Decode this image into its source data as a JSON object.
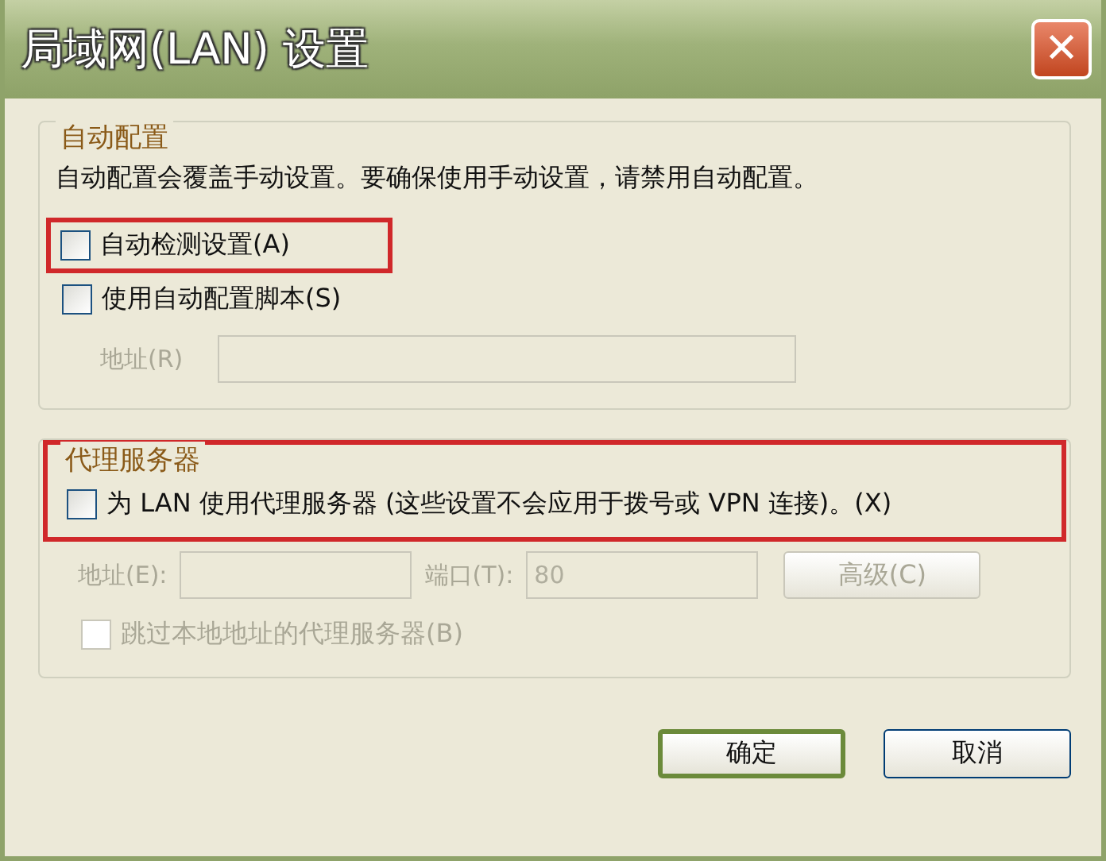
{
  "window": {
    "title": "局域网(LAN) 设置",
    "close_label": "✕"
  },
  "auto_config": {
    "title": "自动配置",
    "description": "自动配置会覆盖手动设置。要确保使用手动设置，请禁用自动配置。",
    "options": [
      {
        "label": "自动检测设置(A)",
        "checked": false,
        "highlighted": true
      },
      {
        "label": "使用自动配置脚本(S)",
        "checked": false,
        "highlighted": false
      }
    ],
    "address": {
      "label": "地址(R)",
      "disabled": true
    }
  },
  "proxy": {
    "title": "代理服务器",
    "highlighted": true,
    "use_proxy": {
      "label": "为 LAN 使用代理服务器 (这些设置不会应用于拨号或 VPN 连接)。(X)",
      "checked": false
    },
    "address": {
      "label": "地址(E):",
      "disabled": true
    },
    "port": {
      "label": "端口(T):",
      "value": "80",
      "disabled": true
    },
    "advanced": {
      "label": "高级(C)",
      "disabled": true
    },
    "bypass": {
      "label": "跳过本地地址的代理服务器(B)",
      "checked": false,
      "disabled": true
    }
  },
  "buttons": [
    {
      "label": "确定",
      "default": true
    },
    {
      "label": "取消",
      "default": false
    }
  ]
}
